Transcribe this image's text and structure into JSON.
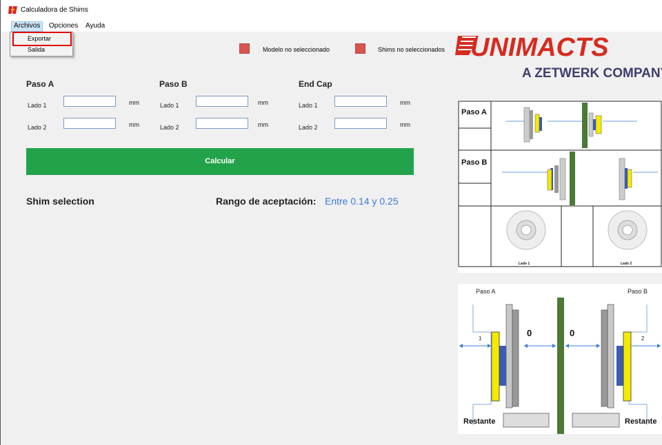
{
  "window": {
    "title": "Calculadora de Shims"
  },
  "menubar": {
    "items": [
      "Archivos",
      "Opciones",
      "Ayuda"
    ]
  },
  "dropdown": {
    "items": [
      "Exportar",
      "Salida"
    ]
  },
  "status": {
    "modelo": "Modelo no seleccionado",
    "shims": "Shims no seleccionados",
    "color": "#d9534f"
  },
  "sections": {
    "paso_a": {
      "title": "Paso A",
      "lado1": "Lado 1",
      "lado2": "Lado 2",
      "unit": "mm"
    },
    "paso_b": {
      "title": "Paso B",
      "lado1": "Lado 1",
      "lado2": "Lado 2",
      "unit": "mm"
    },
    "end_cap": {
      "title": "End Cap",
      "lado1": "Lado 1",
      "lado2": "Lado 2",
      "unit": "mm"
    }
  },
  "calculate_label": "Calcular",
  "shim_selection_label": "Shim selection",
  "range": {
    "label": "Rango de aceptación:",
    "value": "Entre 0.14 y 0.25"
  },
  "logo": {
    "brand": "UNIMACTS",
    "subtitle": "A ZETWERK COMPANY"
  },
  "diagram_top": {
    "paso_a": "Paso A",
    "paso_b": "Paso B",
    "lado1": "Lado 1",
    "lado2": "Lado 2"
  },
  "diagram_bottom": {
    "paso_a": "Paso A",
    "paso_b": "Paso B",
    "left_dim": "1",
    "right_dim": "2",
    "left_value": "0",
    "right_value": "0",
    "restante": "Restante"
  },
  "colors": {
    "accent_green": "#22a34a",
    "range_blue": "#3a7bd5",
    "highlight_red": "#e00000"
  }
}
